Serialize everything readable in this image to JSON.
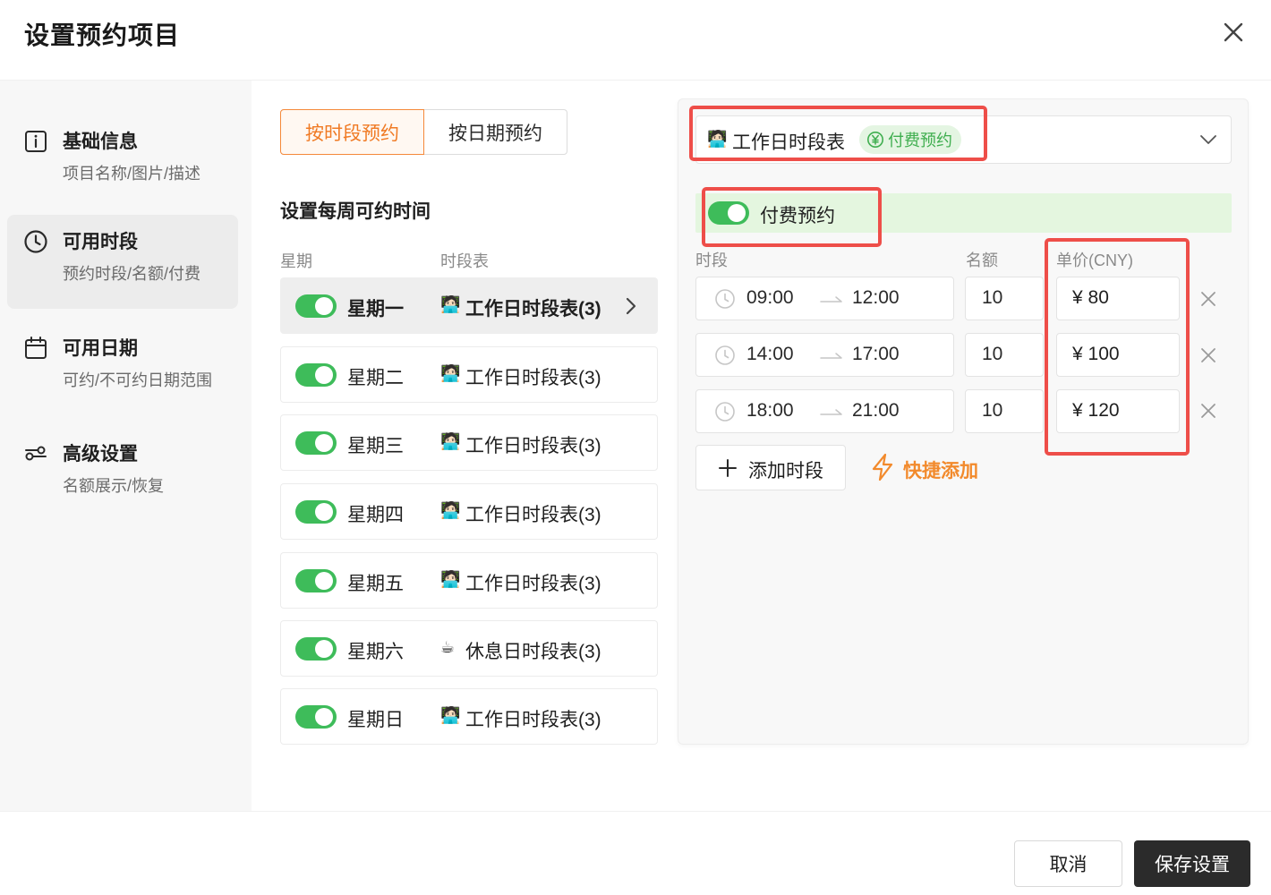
{
  "dialog": {
    "title": "设置预约项目"
  },
  "sidebar": {
    "items": [
      {
        "label": "基础信息",
        "desc": "项目名称/图片/描述",
        "icon": "info-icon",
        "active": false
      },
      {
        "label": "可用时段",
        "desc": "预约时段/名额/付费",
        "icon": "clock-icon",
        "active": true
      },
      {
        "label": "可用日期",
        "desc": "可约/不可约日期范围",
        "icon": "calendar-icon",
        "active": false
      },
      {
        "label": "高级设置",
        "desc": "名额展示/恢复",
        "icon": "settings-slider-icon",
        "active": false
      }
    ]
  },
  "mode_tabs": {
    "by_slot": "按时段预约",
    "by_date": "按日期预约",
    "active": "by_slot"
  },
  "weekly": {
    "section_title": "设置每周可约时间",
    "col_week": "星期",
    "col_schedule": "时段表",
    "days": [
      {
        "name": "星期一",
        "emoji": "🧑🏻‍💻",
        "schedule": "工作日时段表(3)",
        "enabled": true,
        "selected": true
      },
      {
        "name": "星期二",
        "emoji": "🧑🏻‍💻",
        "schedule": "工作日时段表(3)",
        "enabled": true,
        "selected": false
      },
      {
        "name": "星期三",
        "emoji": "🧑🏻‍💻",
        "schedule": "工作日时段表(3)",
        "enabled": true,
        "selected": false
      },
      {
        "name": "星期四",
        "emoji": "🧑🏻‍💻",
        "schedule": "工作日时段表(3)",
        "enabled": true,
        "selected": false
      },
      {
        "name": "星期五",
        "emoji": "🧑🏻‍💻",
        "schedule": "工作日时段表(3)",
        "enabled": true,
        "selected": false
      },
      {
        "name": "星期六",
        "emoji": "☕",
        "schedule": "休息日时段表(3)",
        "enabled": true,
        "selected": false
      },
      {
        "name": "星期日",
        "emoji": "🧑🏻‍💻",
        "schedule": "工作日时段表(3)",
        "enabled": true,
        "selected": false
      }
    ]
  },
  "detail": {
    "schedule_select": {
      "emoji": "🧑🏻‍💻",
      "value": "工作日时段表",
      "tag": "付费预约"
    },
    "paid_toggle": {
      "label": "付费预约",
      "enabled": true
    },
    "headers": {
      "slot": "时段",
      "quota": "名额",
      "price": "单价(CNY)"
    },
    "slots": [
      {
        "start": "09:00",
        "end": "12:00",
        "quota": "10",
        "price": "¥ 80"
      },
      {
        "start": "14:00",
        "end": "17:00",
        "quota": "10",
        "price": "¥ 100"
      },
      {
        "start": "18:00",
        "end": "21:00",
        "quota": "10",
        "price": "¥ 120"
      }
    ],
    "add_slot": "添加时段",
    "quick_add": "快捷添加"
  },
  "footer": {
    "cancel": "取消",
    "save": "保存设置"
  },
  "colors": {
    "toggle_on": "#3ebc5a",
    "accent_orange": "#f07a24",
    "highlight_red": "#ee4e49",
    "paid_bg": "#e4f6df"
  }
}
